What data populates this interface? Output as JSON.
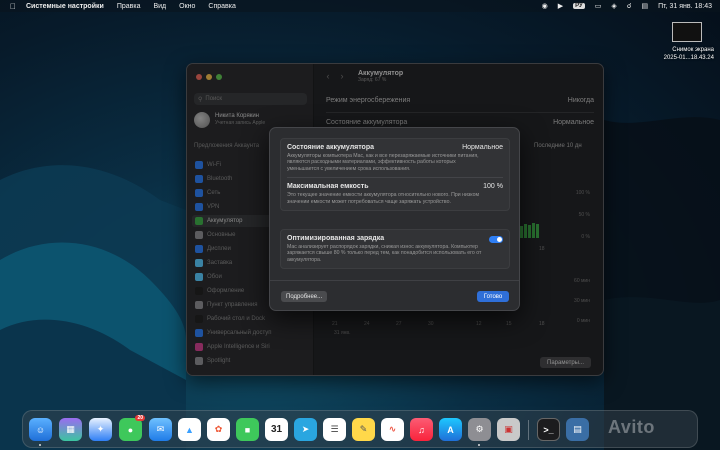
{
  "menubar": {
    "app": "Системные настройки",
    "items": [
      "Правка",
      "Вид",
      "Окно",
      "Справка"
    ],
    "lang": "РУ",
    "clock": "Пт, 31 янв.  18:43"
  },
  "desktop": {
    "screenshot_label_1": "Снимок экрана",
    "screenshot_label_2": "2025-01...18.43.24"
  },
  "sidebar": {
    "search_placeholder": "Поиск",
    "user_name": "Никита Корякин",
    "user_sub": "Учетная запись Apple",
    "section": "Предложения Аккаунта",
    "items": [
      {
        "label": "Wi-Fi",
        "color": "#2f7ff5"
      },
      {
        "label": "Bluetooth",
        "color": "#2f7ff5"
      },
      {
        "label": "Сеть",
        "color": "#2f7ff5"
      },
      {
        "label": "VPN",
        "color": "#2f7ff5"
      },
      {
        "label": "Аккумулятор",
        "color": "#3fae4a"
      },
      {
        "label": "Основные",
        "color": "#8e8e93"
      },
      {
        "label": "Дисплеи",
        "color": "#2f7ff5"
      },
      {
        "label": "Заставка",
        "color": "#5ac8fa"
      },
      {
        "label": "Обои",
        "color": "#5ac8fa"
      },
      {
        "label": "Оформление",
        "color": "#222"
      },
      {
        "label": "Пункт управления",
        "color": "#8e8e93"
      },
      {
        "label": "Рабочий стол и Dock",
        "color": "#222"
      },
      {
        "label": "Универсальный доступ",
        "color": "#2f7ff5"
      },
      {
        "label": "Apple Intelligence и Siri",
        "color": "#d0428f"
      },
      {
        "label": "Spotlight",
        "color": "#8e8e93"
      }
    ]
  },
  "main": {
    "title": "Аккумулятор",
    "subtitle": "Заряд: 67 %",
    "energy_mode_label": "Режим энергосбережения",
    "energy_mode_value": "Никогда",
    "battery_state_label": "Состояние аккумулятора",
    "battery_state_value": "Нормальное",
    "range_tab": "Последние 10 дн",
    "y_ticks": [
      "100 %",
      "50 %",
      "0 %",
      "60 мин",
      "30 мин",
      "0 мин"
    ],
    "x_ticks": [
      "21",
      "24",
      "27",
      "30",
      "12",
      "15",
      "18"
    ],
    "x_date": "31 янв.",
    "x_tick_top": "18",
    "params_button": "Параметры..."
  },
  "sheet": {
    "health_title": "Состояние аккумулятора",
    "health_value": "Нормальное",
    "health_desc": "Аккумуляторы компьютера Mac, как и все перезаряжаемые источники питания, являются расходными материалами, эффективность работы которых уменьшается с увеличением срока использования.",
    "capacity_title": "Максимальная емкость",
    "capacity_value": "100 %",
    "capacity_desc": "Это текущее значение емкости аккумулятора относительно нового. При низком значении емкости может потребоваться чаще заряжать устройство.",
    "optimized_title": "Оптимизированная зарядка",
    "optimized_on": true,
    "optimized_desc": "Mac анализирует распорядок зарядки, снижая износ аккумулятора. Компьютер заряжается свыше 80 % только перед тем, как понадобится использовать его от аккумулятора.",
    "more_button": "Подробнее...",
    "done_button": "Готово"
  },
  "chart_bars": [
    0.6,
    0.7,
    0.65,
    0.75,
    0.7
  ],
  "dock": {
    "mail_badge": "20",
    "calendar_day": "31",
    "watermark": "Avito"
  }
}
